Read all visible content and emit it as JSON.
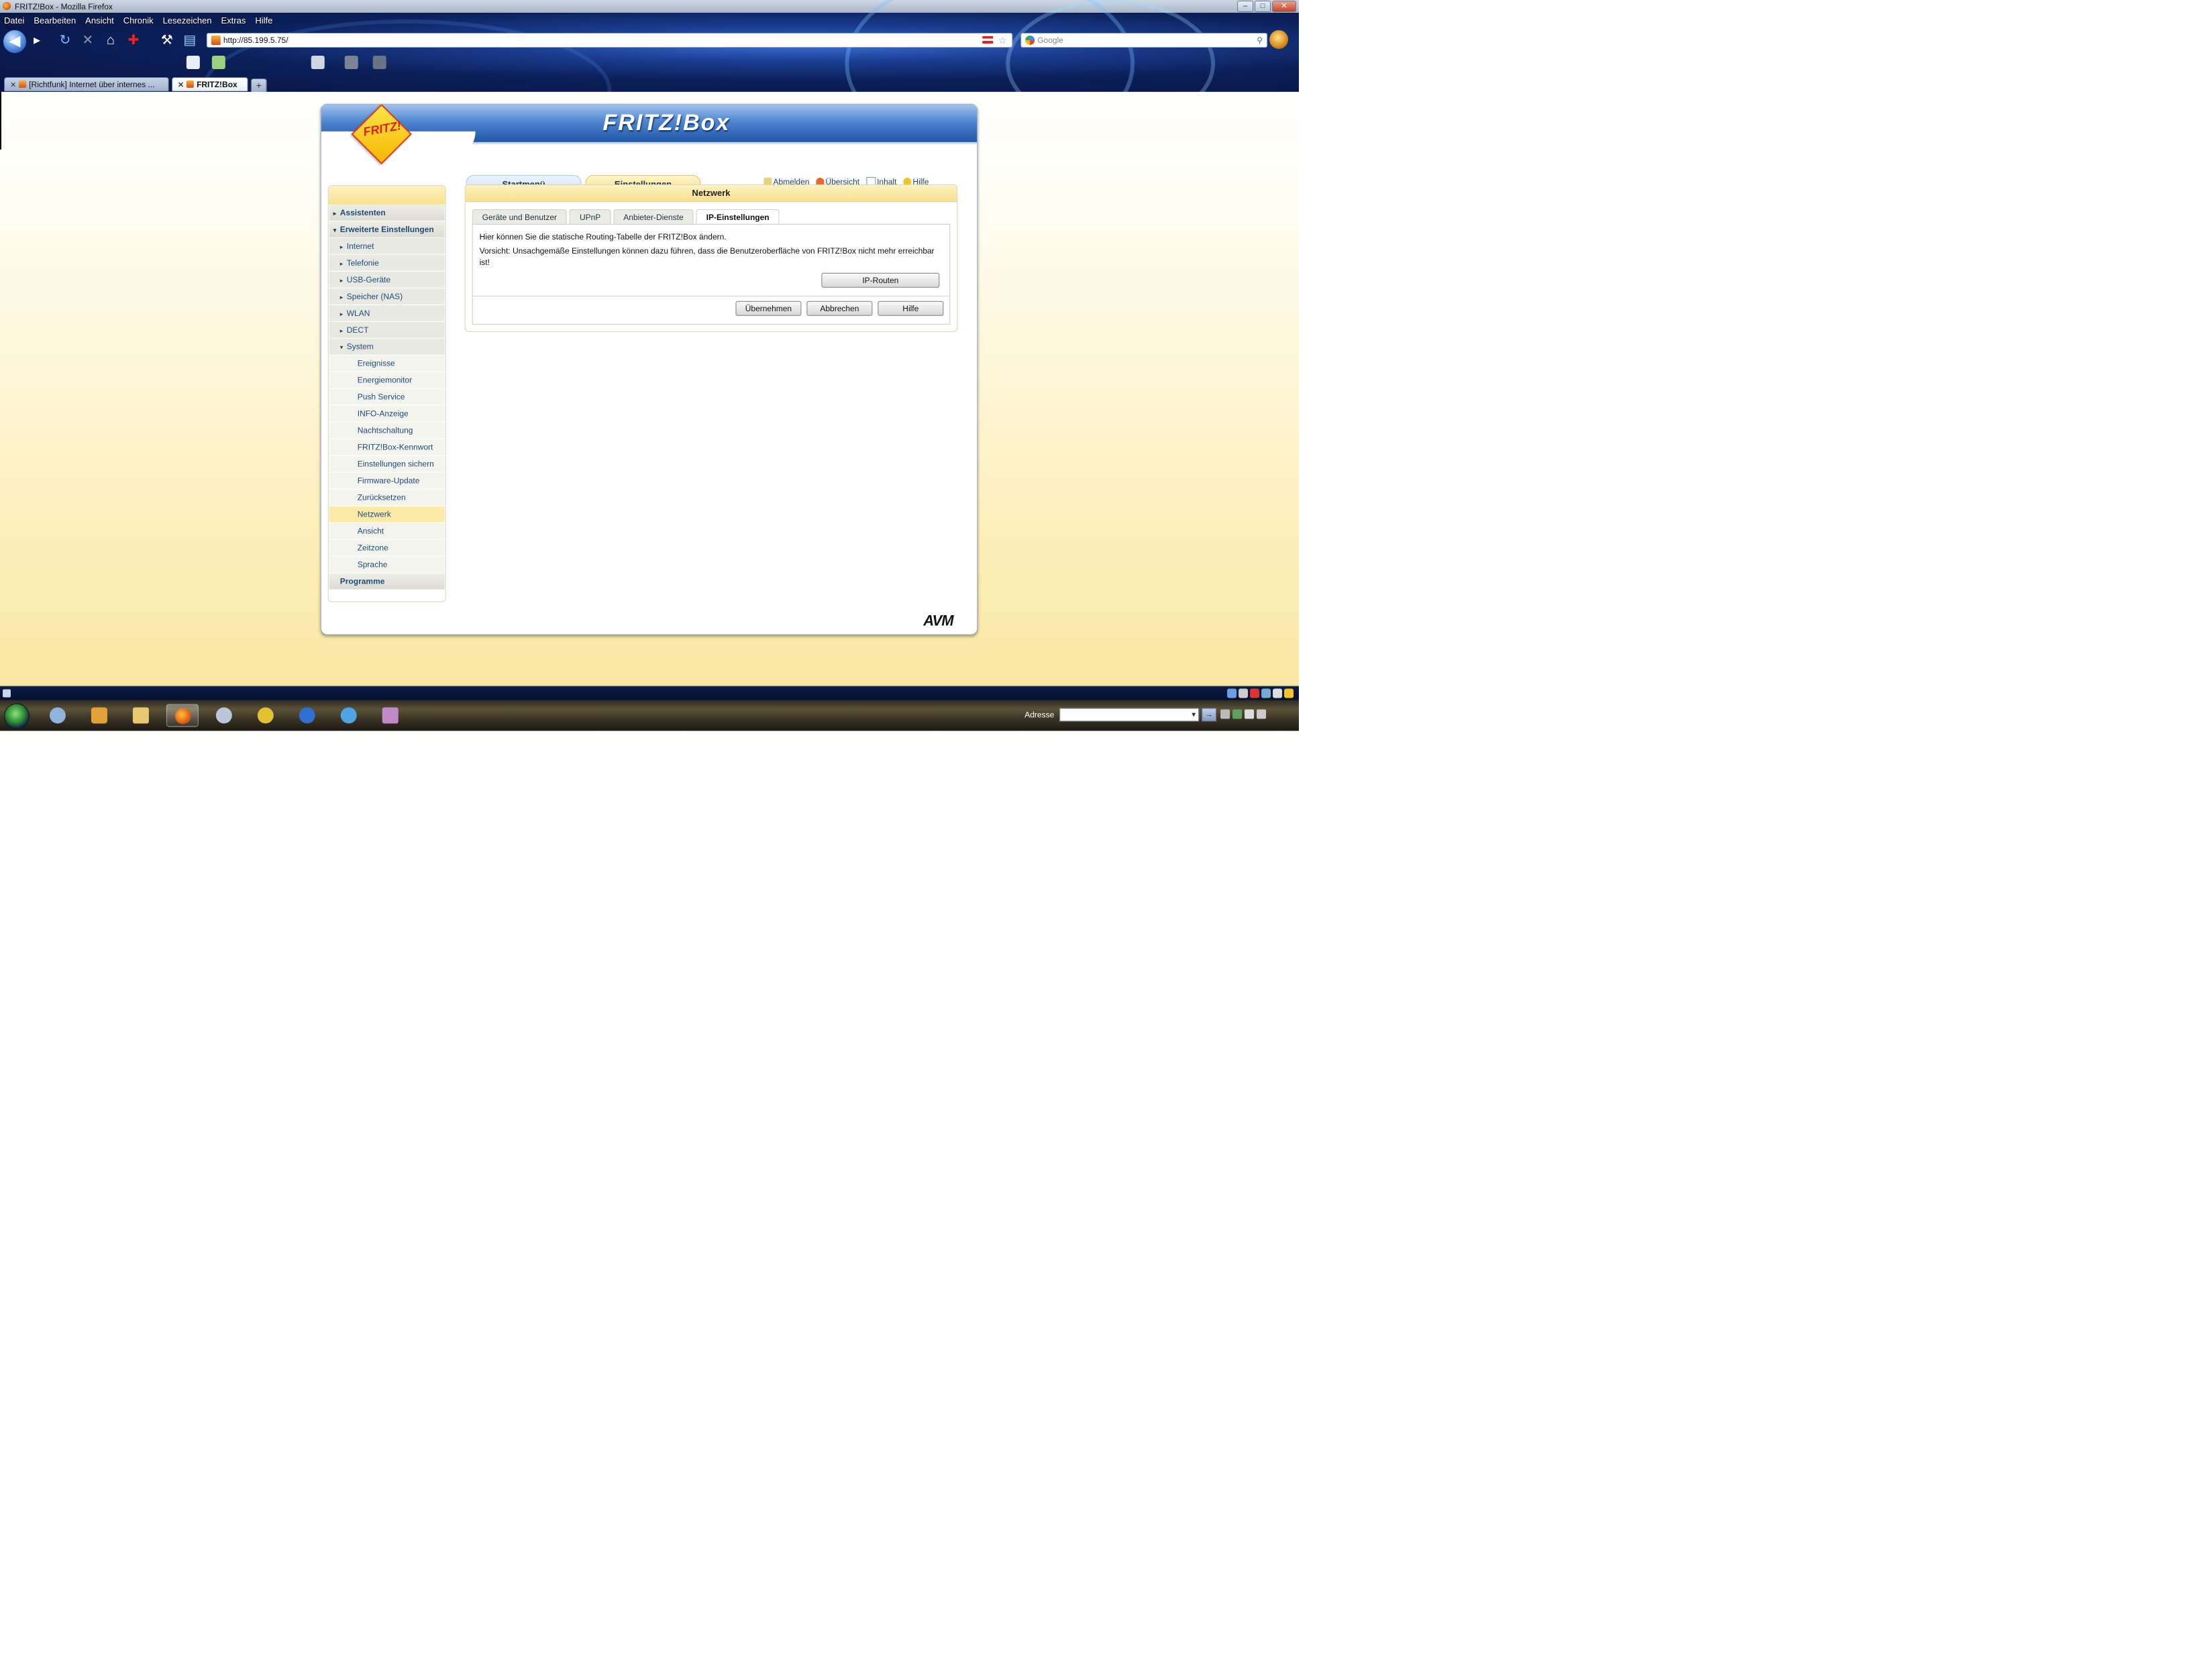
{
  "browser": {
    "window_title": "FRITZ!Box - Mozilla Firefox",
    "window_buttons": [
      "–",
      "□",
      "✕"
    ],
    "menu": [
      "Datei",
      "Bearbeiten",
      "Ansicht",
      "Chronik",
      "Lesezeichen",
      "Extras",
      "Hilfe"
    ],
    "url": "http://85.199.5.75/",
    "search_placeholder": "Google",
    "tabs": [
      {
        "label": "[Richtfunk] Internet über internes ...",
        "active": false
      },
      {
        "label": "FRITZ!Box",
        "active": true
      }
    ],
    "new_tab_label": "+"
  },
  "fritzbox": {
    "brand": "FRITZ!Box",
    "logo_text": "FRITZ!",
    "nav": {
      "start": "Startmenü",
      "settings": "Einstellungen"
    },
    "top_links": [
      "Abmelden",
      "Übersicht",
      "Inhalt",
      "Hilfe"
    ],
    "sidebar": [
      {
        "label": "Assistenten",
        "level": 0,
        "arrow": "▸"
      },
      {
        "label": "Erweiterte Einstellungen",
        "level": 0,
        "arrow": "▾"
      },
      {
        "label": "Internet",
        "level": 1,
        "arrow": "▸"
      },
      {
        "label": "Telefonie",
        "level": 1,
        "arrow": "▸"
      },
      {
        "label": "USB-Geräte",
        "level": 1,
        "arrow": "▸"
      },
      {
        "label": "Speicher (NAS)",
        "level": 1,
        "arrow": "▸"
      },
      {
        "label": "WLAN",
        "level": 1,
        "arrow": "▸"
      },
      {
        "label": "DECT",
        "level": 1,
        "arrow": "▸"
      },
      {
        "label": "System",
        "level": 1,
        "arrow": "▾"
      },
      {
        "label": "Ereignisse",
        "level": 2,
        "arrow": ""
      },
      {
        "label": "Energiemonitor",
        "level": 2,
        "arrow": ""
      },
      {
        "label": "Push Service",
        "level": 2,
        "arrow": ""
      },
      {
        "label": "INFO-Anzeige",
        "level": 2,
        "arrow": ""
      },
      {
        "label": "Nachtschaltung",
        "level": 2,
        "arrow": ""
      },
      {
        "label": "FRITZ!Box-Kennwort",
        "level": 2,
        "arrow": ""
      },
      {
        "label": "Einstellungen sichern",
        "level": 2,
        "arrow": ""
      },
      {
        "label": "Firmware-Update",
        "level": 2,
        "arrow": ""
      },
      {
        "label": "Zurücksetzen",
        "level": 2,
        "arrow": ""
      },
      {
        "label": "Netzwerk",
        "level": 2,
        "arrow": "",
        "active": true
      },
      {
        "label": "Ansicht",
        "level": 2,
        "arrow": ""
      },
      {
        "label": "Zeitzone",
        "level": 2,
        "arrow": ""
      },
      {
        "label": "Sprache",
        "level": 2,
        "arrow": ""
      },
      {
        "label": "Programme",
        "level": 0,
        "arrow": ""
      }
    ],
    "panel": {
      "title": "Netzwerk",
      "tabs": [
        "Geräte und Benutzer",
        "UPnP",
        "Anbieter-Dienste",
        "IP-Einstellungen"
      ],
      "selected_tab": 3,
      "description": "Hier können Sie die statische Routing-Tabelle der FRITZ!Box ändern.",
      "warning": "Vorsicht: Unsachgemäße Einstellungen können dazu führen, dass die Benutzeroberfläche von FRITZ!Box nicht mehr erreichbar ist!",
      "iproutes_button": "IP-Routen",
      "apply_button": "Übernehmen",
      "cancel_button": "Abbrechen",
      "help_button": "Hilfe"
    },
    "footer_logo": "AVM"
  },
  "taskbar": {
    "address_label": "Adresse",
    "address_value": "",
    "go_label": "→"
  },
  "colors": {
    "header_blue": "#1f56a6",
    "panel_yellow": "#f7e08f",
    "link_blue": "#1e4a7a",
    "active_item": "#fbeaa8"
  }
}
